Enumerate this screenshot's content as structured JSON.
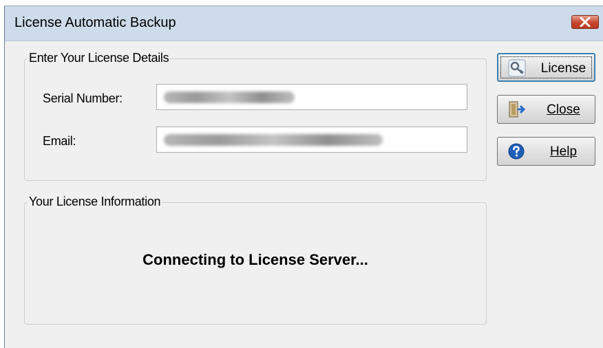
{
  "window": {
    "title": "License Automatic Backup"
  },
  "details": {
    "legend": "Enter Your License Details",
    "serial_label": "Serial Number:",
    "email_label": "Email:"
  },
  "info": {
    "legend": "Your License Information",
    "status": "Connecting to License Server..."
  },
  "buttons": {
    "license": "License",
    "close": "Close",
    "help": "Help"
  },
  "icons": {
    "title_close": "close-x-icon",
    "license": "key-icon",
    "close": "door-exit-icon",
    "help": "question-icon"
  },
  "colors": {
    "titlebar": "#cddbea",
    "close_red": "#c8462d",
    "help_blue": "#1e5fb8"
  }
}
